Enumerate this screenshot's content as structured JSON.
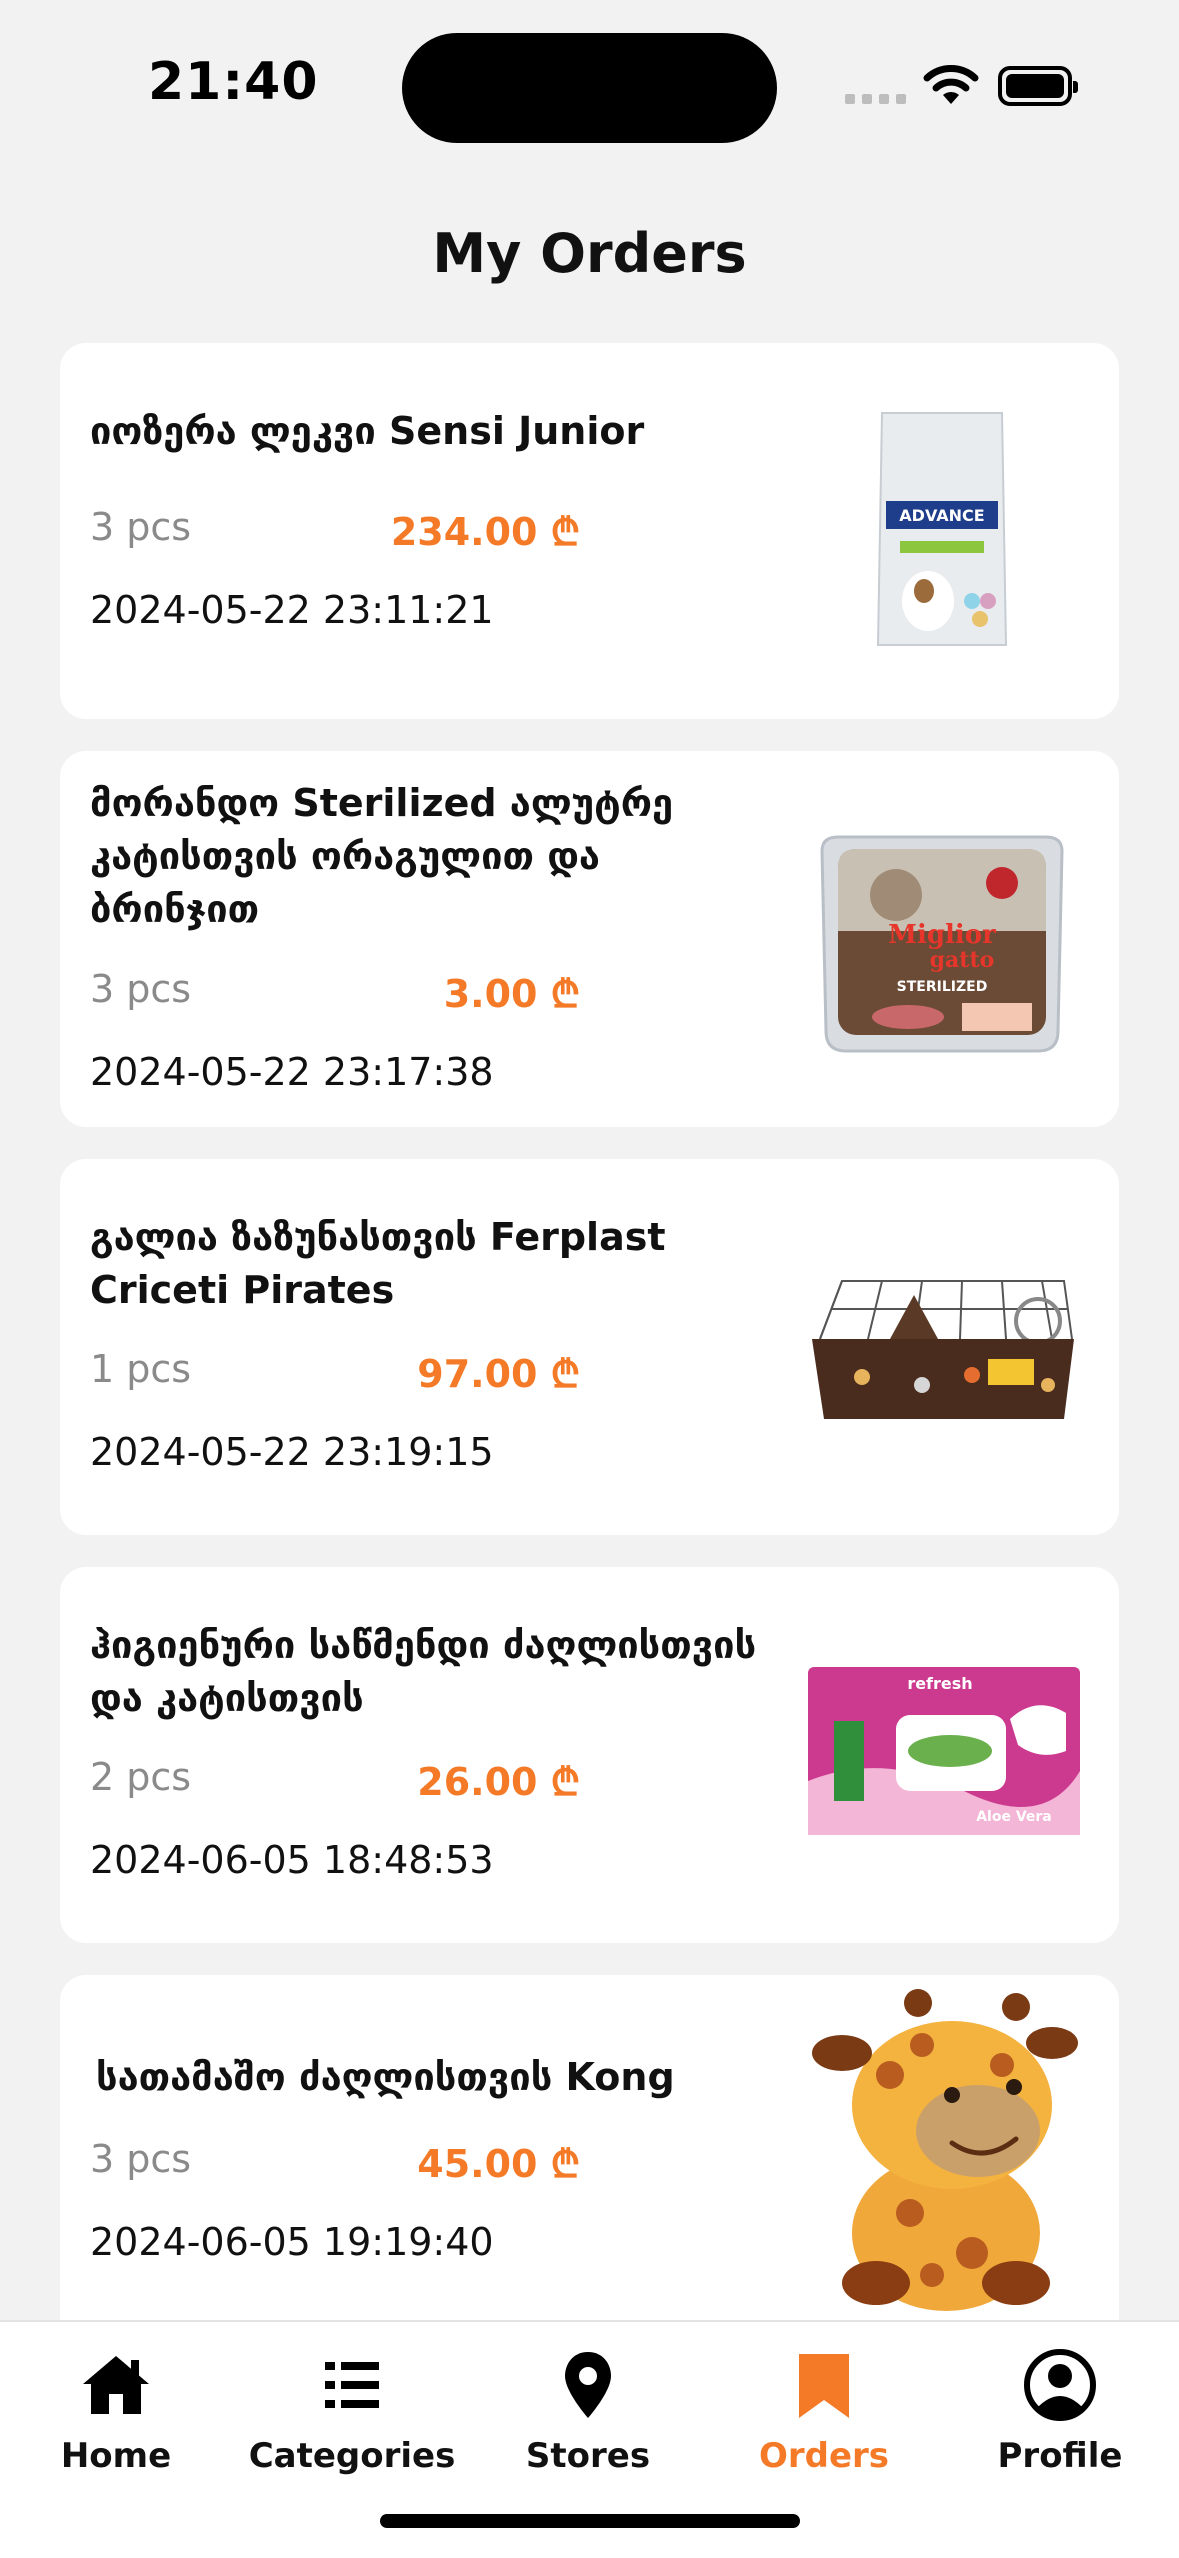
{
  "status": {
    "time": "21:40"
  },
  "page": {
    "title": "My Orders"
  },
  "orders": [
    {
      "name": "იოზერა ლეკვი Sensi Junior",
      "qty": "3 pcs",
      "price": "234.00 ₾",
      "date": "2024-05-22 23:11:21",
      "image": "dog-food-bag"
    },
    {
      "name": "მორანდო Sterilized ალუტრე კატისთვის ორაგულით და ბრინჯით",
      "qty": "3 pcs",
      "price": "3.00 ₾",
      "date": "2024-05-22 23:17:38",
      "image": "cat-food-tray"
    },
    {
      "name": "გალია ზაზუნასთვის Ferplast Criceti Pirates",
      "qty": "1 pcs",
      "price": "97.00 ₾",
      "date": "2024-05-22 23:19:15",
      "image": "hamster-cage"
    },
    {
      "name": "ჰიგიენური საწმენდი ძაღლისთვის და კატისთვის",
      "qty": "2 pcs",
      "price": "26.00 ₾",
      "date": "2024-06-05 18:48:53",
      "image": "wet-wipes-pack"
    },
    {
      "name": "სათამაშო ძაღლისთვის Kong",
      "qty": "3 pcs",
      "price": "45.00 ₾",
      "date": "2024-06-05 19:19:40",
      "image": "giraffe-plush-toy"
    }
  ],
  "nav": [
    {
      "label": "Home",
      "icon": "home-icon"
    },
    {
      "label": "Categories",
      "icon": "list-icon"
    },
    {
      "label": "Stores",
      "icon": "location-pin-icon"
    },
    {
      "label": "Orders",
      "icon": "bookmark-icon",
      "active": true
    },
    {
      "label": "Profile",
      "icon": "profile-icon"
    }
  ],
  "colors": {
    "accent": "#f47a28",
    "background": "#f2f2f2",
    "card": "#ffffff"
  }
}
